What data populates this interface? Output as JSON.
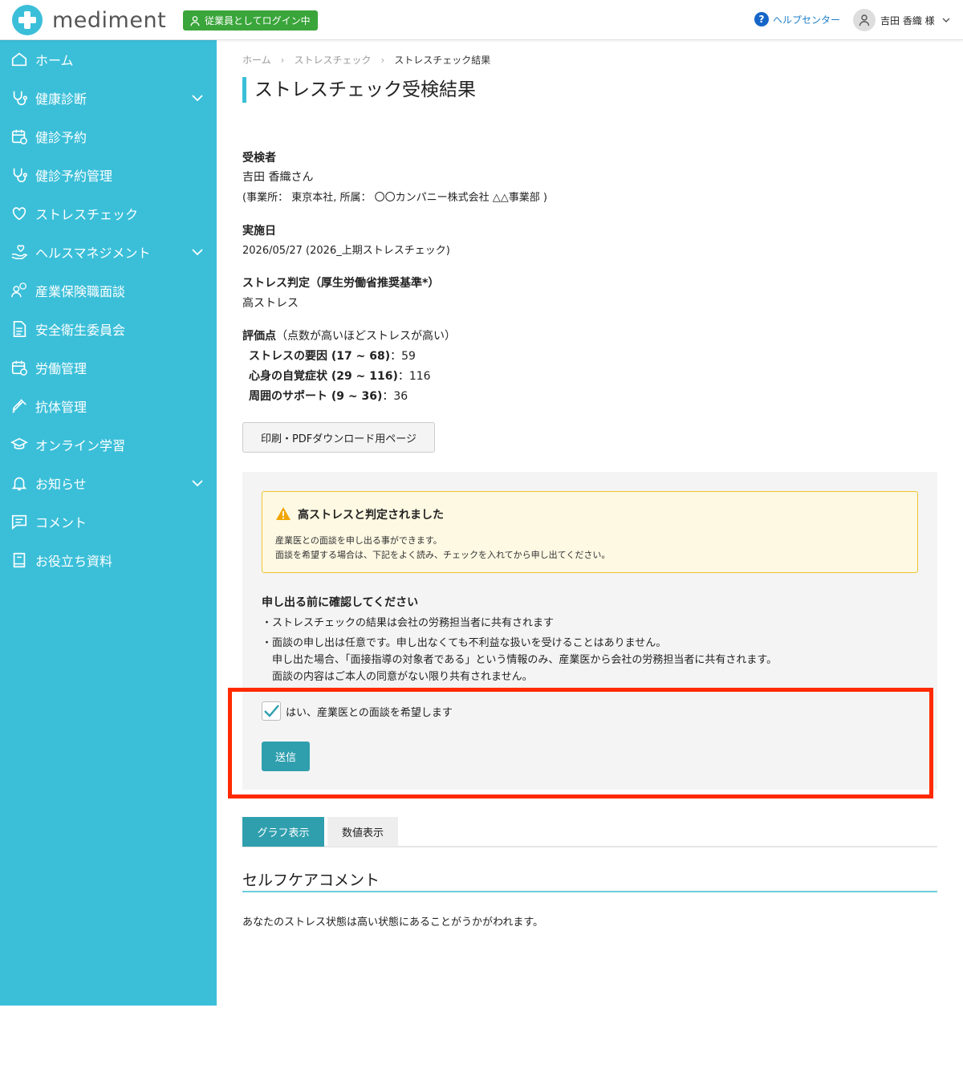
{
  "header": {
    "logo_text": "mediment",
    "login_badge": "従業員としてログイン中",
    "help_center": "ヘルプセンター",
    "user_name": "吉田 香織 様"
  },
  "sidebar": {
    "items": [
      {
        "label": "ホーム",
        "icon": "home-icon"
      },
      {
        "label": "健康診断",
        "icon": "stethoscope-icon",
        "expandable": true
      },
      {
        "label": "健診予約",
        "icon": "calendar-clock-icon"
      },
      {
        "label": "健診予約管理",
        "icon": "stethoscope-icon"
      },
      {
        "label": "ストレスチェック",
        "icon": "heart-icon"
      },
      {
        "label": "ヘルスマネジメント",
        "icon": "hand-heart-icon",
        "expandable": true
      },
      {
        "label": "産業保険職面談",
        "icon": "person-chat-icon"
      },
      {
        "label": "安全衛生委員会",
        "icon": "document-icon"
      },
      {
        "label": "労働管理",
        "icon": "calendar-clock-icon"
      },
      {
        "label": "抗体管理",
        "icon": "syringe-icon"
      },
      {
        "label": "オンライン学習",
        "icon": "graduation-cap-icon"
      },
      {
        "label": "お知らせ",
        "icon": "bell-icon",
        "expandable": true
      },
      {
        "label": "コメント",
        "icon": "comment-icon"
      },
      {
        "label": "お役立ち資料",
        "icon": "book-icon"
      }
    ]
  },
  "breadcrumb": {
    "home": "ホーム",
    "stress": "ストレスチェック",
    "current": "ストレスチェック結果"
  },
  "page_title": "ストレスチェック受検結果",
  "examinee": {
    "label": "受検者",
    "name": "吉田 香織さん",
    "affiliation": "(事業所： 東京本社, 所属： 〇〇カンパニー株式会社 △△事業部 )"
  },
  "exam_date": {
    "label": "実施日",
    "value": "2026/05/27 (2026_上期ストレスチェック)"
  },
  "judgement": {
    "label": "ストレス判定（厚生労働省推奨基準*）",
    "value": "高ストレス"
  },
  "scores": {
    "label_bold": "評価点",
    "label_note": "（点数が高いほどストレスが高い）",
    "items": [
      {
        "name": "ストレスの要因 (17 ~ 68)",
        "value": "：59"
      },
      {
        "name": "心身の自覚症状 (29 ~ 116)",
        "value": "：116"
      },
      {
        "name": "周囲のサポート (9 ~ 36)",
        "value": "：36"
      }
    ]
  },
  "print_button": "印刷・PDFダウンロード用ページ",
  "alert": {
    "title": "高ストレスと判定されました",
    "line1": "産業医との面談を申し出る事ができます。",
    "line2": "面談を希望する場合は、下記をよく読み、チェックを入れてから申し出てください。"
  },
  "confirm": {
    "title": "申し出る前に確認してください",
    "lines": [
      "・ストレスチェックの結果は会社の労務担当者に共有されます",
      "・面談の申し出は任意です。申し出なくても不利益な扱いを受けることはありません。",
      "　申し出た場合、「面接指導の対象者である」という情報のみ、産業医から会社の労務担当者に共有されます。",
      "　面談の内容はご本人の同意がない限り共有されません。"
    ]
  },
  "checkbox": {
    "label": "はい、産業医との面談を希望します",
    "checked": true
  },
  "send_button": "送信",
  "tabs": {
    "graph": "グラフ表示",
    "numeric": "数値表示",
    "active": "graph"
  },
  "selfcare": {
    "title": "セルフケアコメント",
    "text": "あなたのストレス状態は高い状態にあることがうかがわれます。"
  },
  "colors": {
    "sidebar": "#3bbfd9",
    "accent": "#2f9fae",
    "login_badge": "#3aa53a",
    "highlight": "#ff2a00",
    "alert_bg": "#fef9e3",
    "alert_border": "#f0c330"
  }
}
